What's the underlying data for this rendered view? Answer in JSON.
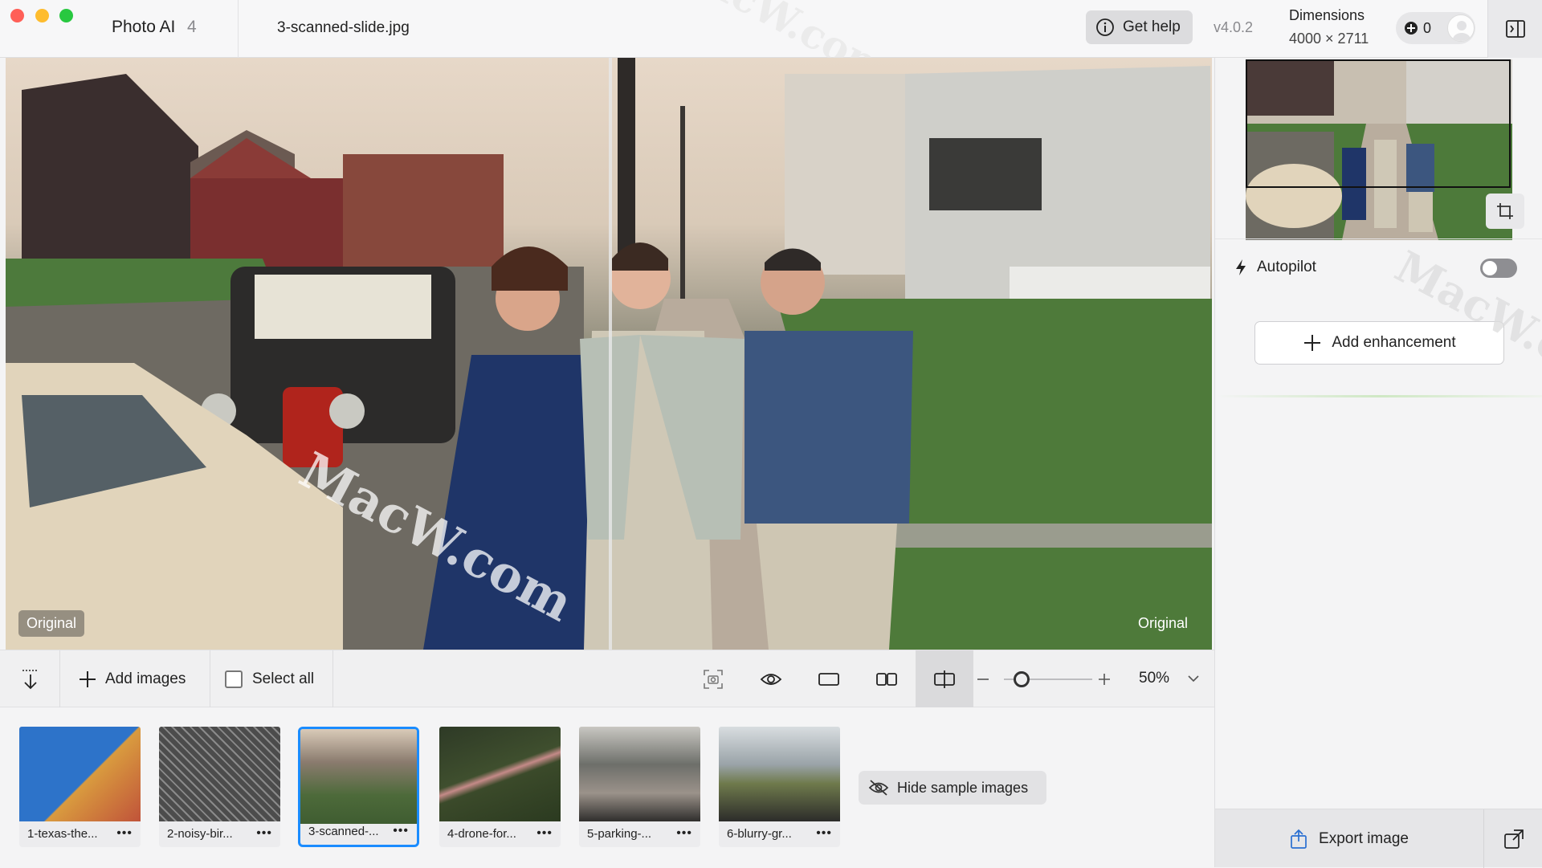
{
  "titlebar": {
    "app_name": "Photo AI",
    "app_version_badge": "4",
    "file_name": "3-scanned-slide.jpg",
    "help_label": "Get help",
    "version": "v4.0.2",
    "dimensions_title": "Dimensions",
    "dimensions_value": "4000 × 2711",
    "credits": "0"
  },
  "preview": {
    "left_label": "Original",
    "right_label": "Original",
    "watermark": "MacW.com"
  },
  "toolbar": {
    "add_images": "Add images",
    "select_all": "Select all",
    "zoom": "50%",
    "zoom_slider_fraction": 0.2
  },
  "thumbnails": [
    {
      "label": "1-texas-the...",
      "dots": "•••"
    },
    {
      "label": "2-noisy-bir...",
      "dots": "•••"
    },
    {
      "label": "3-scanned-...",
      "dots": "•••"
    },
    {
      "label": "4-drone-for...",
      "dots": "•••"
    },
    {
      "label": "5-parking-...",
      "dots": "•••"
    },
    {
      "label": "6-blurry-gr...",
      "dots": "•••"
    }
  ],
  "strip": {
    "hide_samples": "Hide sample images"
  },
  "panel": {
    "autopilot": "Autopilot",
    "autopilot_on": false,
    "add_enhancement": "Add enhancement",
    "export": "Export image"
  },
  "colors": {
    "accent": "#1a8cff",
    "toggle_off": "#8e8e92"
  }
}
